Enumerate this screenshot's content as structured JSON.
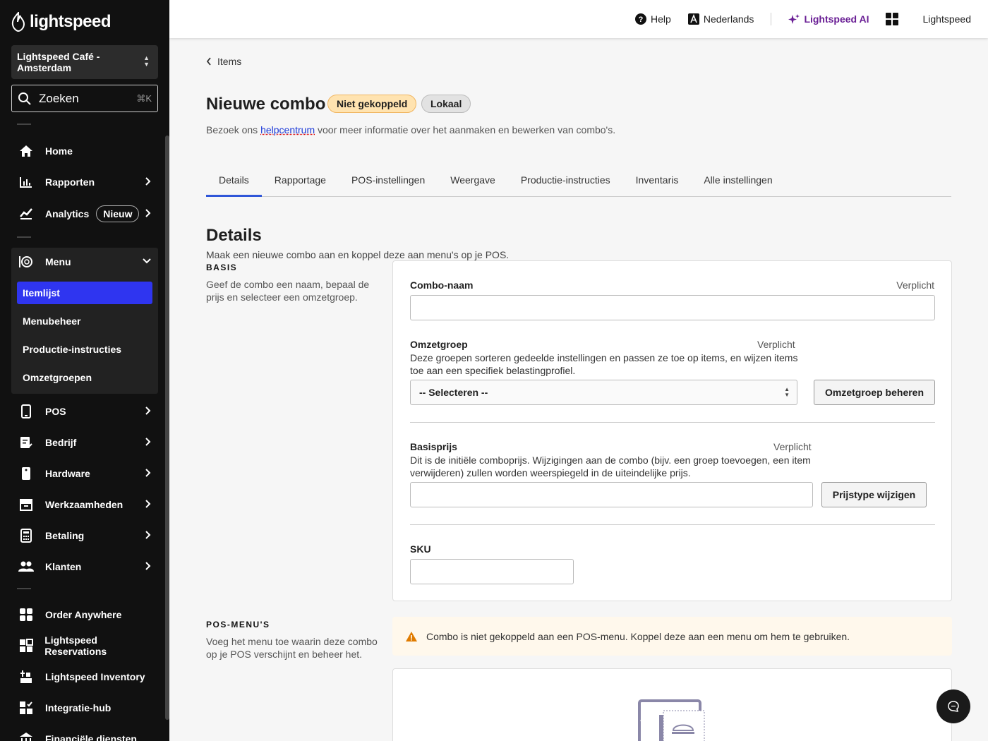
{
  "sidebar": {
    "logo": "lightspeed",
    "location": "Lightspeed Café - Amsterdam",
    "search": {
      "label": "Zoeken",
      "shortcut": "⌘K"
    },
    "nav": {
      "home": "Home",
      "reports": "Rapporten",
      "analytics": "Analytics",
      "analytics_badge": "Nieuw",
      "menu": "Menu",
      "pos": "POS",
      "company": "Bedrijf",
      "hardware": "Hardware",
      "operations": "Werkzaamheden",
      "payment": "Betaling",
      "customers": "Klanten",
      "order_anywhere": "Order Anywhere",
      "reservations": "Lightspeed Reservations",
      "inventory": "Lightspeed Inventory",
      "integrations": "Integratie-hub",
      "financial": "Financiële diensten"
    },
    "menu_sub": [
      "Itemlijst",
      "Menubeheer",
      "Productie-instructies",
      "Omzetgroepen"
    ]
  },
  "topbar": {
    "help": "Help",
    "language": "Nederlands",
    "ai": "Lightspeed AI",
    "account": "Lightspeed"
  },
  "page": {
    "breadcrumb": "Items",
    "title": "Nieuwe combo",
    "status_badge": "Niet gekoppeld",
    "scope_badge": "Lokaal",
    "desc_before": "Bezoek ons ",
    "desc_link": "helpcentrum",
    "desc_after": " voor meer informatie over het aanmaken en bewerken van combo's.",
    "tabs": [
      "Details",
      "Rapportage",
      "POS-instellingen",
      "Weergave",
      "Productie-instructies",
      "Inventaris",
      "Alle instellingen"
    ],
    "details_title": "Details",
    "details_sub": "Maak een nieuwe combo aan en koppel deze aan menu's op je POS."
  },
  "basis": {
    "label": "BASIS",
    "desc": "Geef de combo een naam, bepaal de prijs en selecteer een omzetgroep.",
    "name_label": "Combo-naam",
    "required": "Verplicht",
    "name_value": "",
    "group_label": "Omzetgroep",
    "group_help": "Deze groepen sorteren gedeelde instellingen en passen ze toe op items, en wijzen items toe aan een specifiek belastingprofiel.",
    "group_value": "-- Selecteren --",
    "group_button": "Omzetgroep beheren",
    "price_label": "Basisprijs",
    "price_help": "Dit is de initiële comboprijs. Wijzigingen aan de combo (bijv. een groep toevoegen, een item verwijderen) zullen worden weerspiegeld in de uiteindelijke prijs.",
    "price_value": "",
    "price_button": "Prijstype wijzigen",
    "sku_label": "SKU",
    "sku_value": ""
  },
  "pos_menus": {
    "label": "POS-MENU'S",
    "desc": "Voeg het menu toe waarin deze combo op je POS verschijnt en beheer het.",
    "alert": "Combo is niet gekoppeld aan een POS-menu. Koppel deze aan een menu om hem te gebruiken."
  },
  "colors": {
    "sidebar_bg": "#111111",
    "active_nav": "#2f35f0",
    "ai_purple": "#6a1f95",
    "tab_underline": "#2f56d8",
    "badge_orange": "#ffe3b0",
    "alert_bg": "#fff8ec",
    "warning": "#e07b00"
  }
}
